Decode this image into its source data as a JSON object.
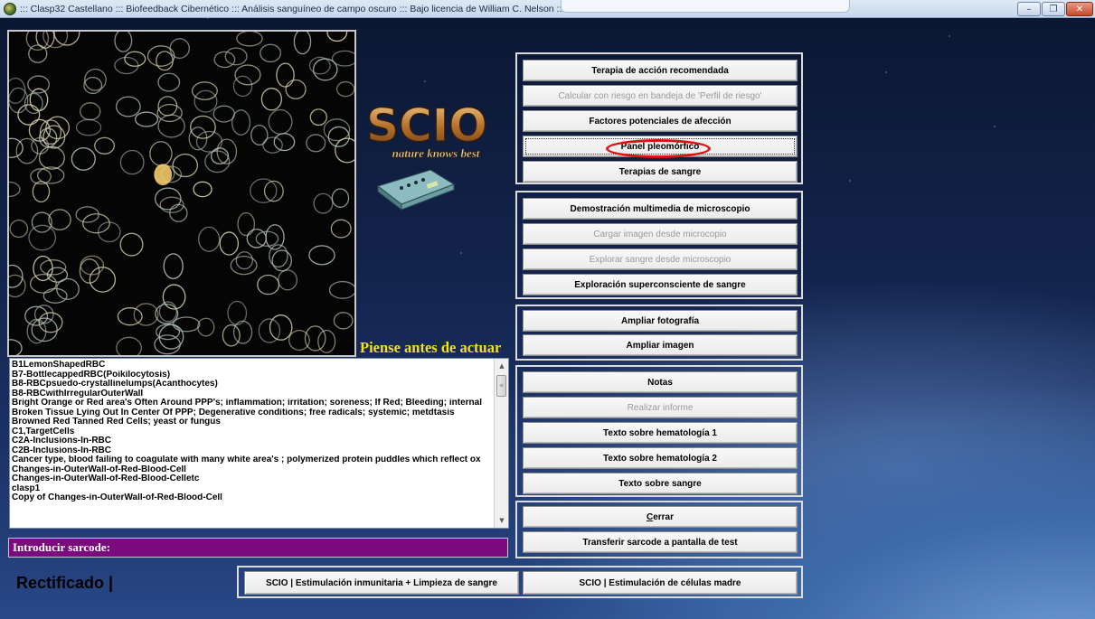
{
  "window": {
    "title": "::: Clasp32 Castellano ::: Biofeedback Cibernético ::: Análisis sanguíneo de campo oscuro ::: Bajo licencia de William C. Nelson :::",
    "controls": {
      "minimize": "–",
      "maximize": "❐",
      "close": "✕"
    }
  },
  "logo": {
    "brand": "SCIO",
    "tagline": "nature knows best"
  },
  "motto": "Piense antes de actuar",
  "list": {
    "items": [
      "B1LemonShapedRBC",
      "B7-BottlecappedRBC(Poikilocytosis)",
      "B8-RBCpsuedo-crystallinelumps(Acanthocytes)",
      "B8-RBCwithIrregularOuterWall",
      "Bright Orange or Red area's Often Around PPP's; inflammation; irritation; soreness; If Red; Bleeding; internal",
      "Broken Tissue Lying Out In Center Of PPP; Degenerative conditions; free radicals; systemic; metdtasis",
      "Browned Red Tanned Red Cells; yeast or fungus",
      "C1,TargetCells",
      "C2A-Inclusions-In-RBC",
      "C2B-Inclusions-In-RBC",
      "Cancer type, blood failing to coagulate with many white area's ; polymerized protein puddles which reflect ox",
      "Changes-in-OuterWall-of-Red-Blood-Cell",
      "Changes-in-OuterWall-of-Red-Blood-Celletc",
      "clasp1",
      "Copy of Changes-in-OuterWall-of-Red-Blood-Cell"
    ],
    "scroll_up": "▲",
    "scroll_down": "▼",
    "thumb_grip": "≡"
  },
  "sarcode": {
    "label": "Introducir sarcode:"
  },
  "status": {
    "text": "Rectificado |"
  },
  "panels": {
    "therapy": {
      "buttons": [
        {
          "label": "Terapia de acción recomendada",
          "disabled": false
        },
        {
          "label": "Calcular con riesgo en bandeja de 'Perfil de riesgo'",
          "disabled": true
        },
        {
          "label": "Factores potenciales de afección",
          "disabled": false
        },
        {
          "label": "Panel pleomórfico",
          "disabled": false
        },
        {
          "label": "Terapias de sangre",
          "disabled": false
        }
      ]
    },
    "microscope": {
      "buttons": [
        {
          "label": "Demostración multimedia de microscopio",
          "disabled": false
        },
        {
          "label": "Cargar imagen desde microcopio",
          "disabled": true
        },
        {
          "label": "Explorar sangre desde microscopio",
          "disabled": true
        },
        {
          "label": "Exploración superconsciente de sangre",
          "disabled": false
        }
      ]
    },
    "photo": {
      "buttons": [
        {
          "label": "Ampliar fotografía",
          "disabled": false
        },
        {
          "label": "Ampliar imagen",
          "disabled": false
        }
      ]
    },
    "notes": {
      "buttons": [
        {
          "label": "Notas",
          "disabled": false
        },
        {
          "label": "Realizar informe",
          "disabled": true
        },
        {
          "label": "Texto sobre hematología 1",
          "disabled": false
        },
        {
          "label": "Texto sobre hematología 2",
          "disabled": false
        },
        {
          "label": "Texto sobre sangre",
          "disabled": false
        }
      ]
    },
    "close": {
      "close_mnemonic": "C",
      "close_rest": "errar",
      "transfer_label": "Transferir sarcode a pantalla de test"
    }
  },
  "bottom": {
    "immune_label": "SCIO | Estimulación inmunitaria + Limpieza de sangre",
    "stemcell_label": "SCIO | Estimulación de células madre"
  },
  "colors": {
    "motto": "#f5e315",
    "sarcode_bg": "#7b0a7e",
    "highlight_ring": "#e01010"
  }
}
